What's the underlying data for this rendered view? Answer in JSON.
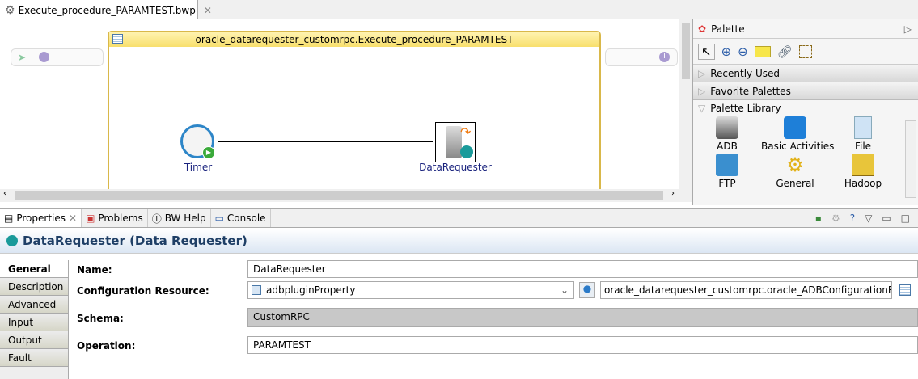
{
  "editor": {
    "tab_title": "Execute_procedure_PARAMTEST.bwp",
    "process_title": "oracle_datarequester_customrpc.Execute_procedure_PARAMTEST",
    "nodes": [
      {
        "label": "Timer"
      },
      {
        "label": "DataRequester"
      }
    ]
  },
  "palette": {
    "title": "Palette",
    "sections": [
      "Recently Used",
      "Favorite Palettes",
      "Palette Library"
    ],
    "items": [
      "ADB",
      "Basic Activities",
      "File",
      "FTP",
      "General",
      "Hadoop"
    ]
  },
  "bottom": {
    "tabs": [
      "Properties",
      "Problems",
      "BW Help",
      "Console"
    ],
    "title": "DataRequester (Data Requester)",
    "side_tabs": [
      "General",
      "Description",
      "Advanced",
      "Input",
      "Output",
      "Fault"
    ],
    "fields": {
      "name_label": "Name:",
      "name_value": "DataRequester",
      "config_label": "Configuration Resource:",
      "config_value": "adbpluginProperty",
      "config_resource": "oracle_datarequester_customrpc.oracle_ADBConfigurationResource",
      "schema_label": "Schema:",
      "schema_value": "CustomRPC",
      "operation_label": "Operation:",
      "operation_value": "PARAMTEST"
    }
  }
}
